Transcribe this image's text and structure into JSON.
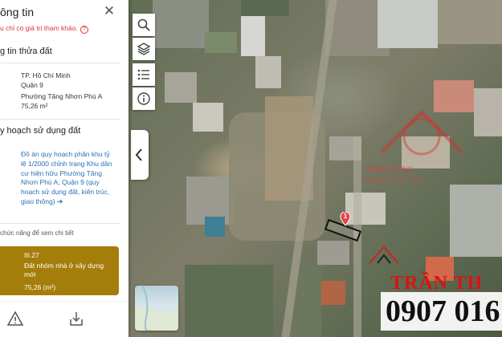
{
  "panel": {
    "title": "ông tin",
    "note": "u chỉ có giá trị tham khảo.",
    "note_icon": "?",
    "parcel_section_title": "g tin thửa đất",
    "parcel": {
      "city": "TP. Hồ Chí Minh",
      "district": "Quận 9",
      "ward": "Phường Tăng Nhơn Phú A",
      "area": "75,26 m²"
    },
    "landuse_section_title": "y hoạch sử dụng đất",
    "plan_link": "Đồ án quy hoạch phân khu tỷ lệ 1/2000 chỉnh trang Khu dân cư hiện hữu Phường Tăng Nhơn Phú A, Quận 9 (quy hoạch sử dụng đất, kiến trúc, giao thông)",
    "plan_link_arrow": "➔",
    "hint": "chức năng để xem chi tiết",
    "zone": {
      "code": "III.27",
      "type": "Đất nhóm nhà ở xây dựng mới",
      "area": "75,26 (m²)"
    }
  },
  "map": {
    "marker_label": "1",
    "watermark_name": "TRẦN TH",
    "watermark_phone": "0907 016",
    "watermark_faint_name": "TRẦN THỦNG",
    "watermark_faint_phone": "0907 016 378"
  },
  "colors": {
    "zone_card": "#a57d0a",
    "link": "#2a6fb7",
    "note": "#dd3333",
    "marker": "#e04848"
  },
  "icons": [
    "close-icon",
    "search-icon",
    "layers-icon",
    "list-icon",
    "info-icon",
    "chevron-left-icon",
    "warning-icon",
    "download-icon"
  ]
}
